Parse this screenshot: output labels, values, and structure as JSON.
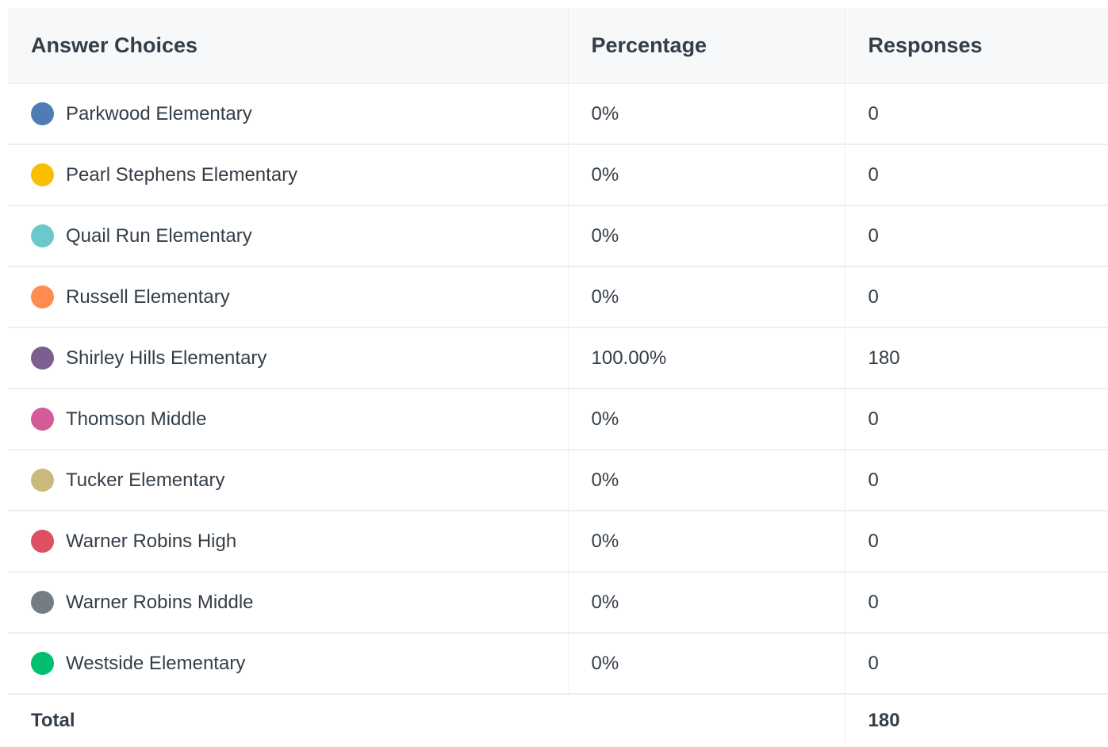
{
  "table": {
    "headers": {
      "choice": "Answer Choices",
      "percentage": "Percentage",
      "responses": "Responses"
    },
    "rows": [
      {
        "label": "Parkwood Elementary",
        "percentage": "0%",
        "responses": "0",
        "color": "#507cb6"
      },
      {
        "label": "Pearl Stephens Elementary",
        "percentage": "0%",
        "responses": "0",
        "color": "#f9be00"
      },
      {
        "label": "Quail Run Elementary",
        "percentage": "0%",
        "responses": "0",
        "color": "#6bc8cd"
      },
      {
        "label": "Russell Elementary",
        "percentage": "0%",
        "responses": "0",
        "color": "#ff8b4f"
      },
      {
        "label": "Shirley Hills Elementary",
        "percentage": "100.00%",
        "responses": "180",
        "color": "#7d5e90"
      },
      {
        "label": "Thomson Middle",
        "percentage": "0%",
        "responses": "0",
        "color": "#d55a99"
      },
      {
        "label": "Tucker Elementary",
        "percentage": "0%",
        "responses": "0",
        "color": "#c9b97a"
      },
      {
        "label": "Warner Robins High",
        "percentage": "0%",
        "responses": "0",
        "color": "#dc5061"
      },
      {
        "label": "Warner Robins Middle",
        "percentage": "0%",
        "responses": "0",
        "color": "#757d84"
      },
      {
        "label": "Westside Elementary",
        "percentage": "0%",
        "responses": "0",
        "color": "#00bf6f"
      }
    ],
    "total": {
      "label": "Total",
      "responses": "180"
    }
  }
}
